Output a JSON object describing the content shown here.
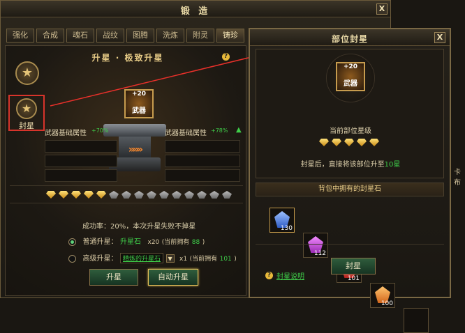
{
  "main": {
    "title": "锻 造",
    "close": "X",
    "tabs": [
      "强化",
      "合成",
      "魂石",
      "战纹",
      "图腾",
      "洗炼",
      "附灵",
      "铸珍"
    ],
    "section_title": "升星 · 极致升星",
    "help_mark": "?",
    "side_label": "封星",
    "weapon_level": "+20",
    "weapon_name": "武器",
    "attr_left_label": "武器基础属性",
    "attr_left_value": "+70%",
    "attr_right_label": "武器基础属性",
    "attr_right_value": "+78%",
    "star_gold_count": 5,
    "star_gray_count": 10,
    "success_text": "成功率：20%，本次升星失败不掉星",
    "normal_label": "普通升星：",
    "normal_item": "升星石",
    "normal_qty": "x20",
    "normal_have_prefix": "(当前拥有",
    "normal_have": "88",
    "normal_have_suffix": ")",
    "adv_label": "高级升星：",
    "adv_item": "精炼的升星石",
    "adv_qty": "x1",
    "adv_have_prefix": "(当前拥有",
    "adv_have": "101",
    "adv_have_suffix": ")",
    "btn_upgrade": "升星",
    "btn_auto": "自动升星"
  },
  "popup": {
    "title": "部位封星",
    "close": "X",
    "weapon_level": "+20",
    "weapon_name": "武器",
    "current_label": "当前部位星级",
    "star_count": 5,
    "desc_prefix": "封星后，直接将该部位升至",
    "desc_value": "10星",
    "bag_title": "背包中拥有的封星石",
    "stones": [
      {
        "count": "130",
        "color": "#4c7fe0"
      },
      {
        "count": "112",
        "color": "#c54ad6"
      },
      {
        "count": "101",
        "color": "#d63a3a"
      },
      {
        "count": "100",
        "color": "#e8872c"
      }
    ],
    "btn_seal": "封星",
    "help_mark": "?",
    "help_link": "封星说明"
  },
  "right_edge_text": "卡布"
}
